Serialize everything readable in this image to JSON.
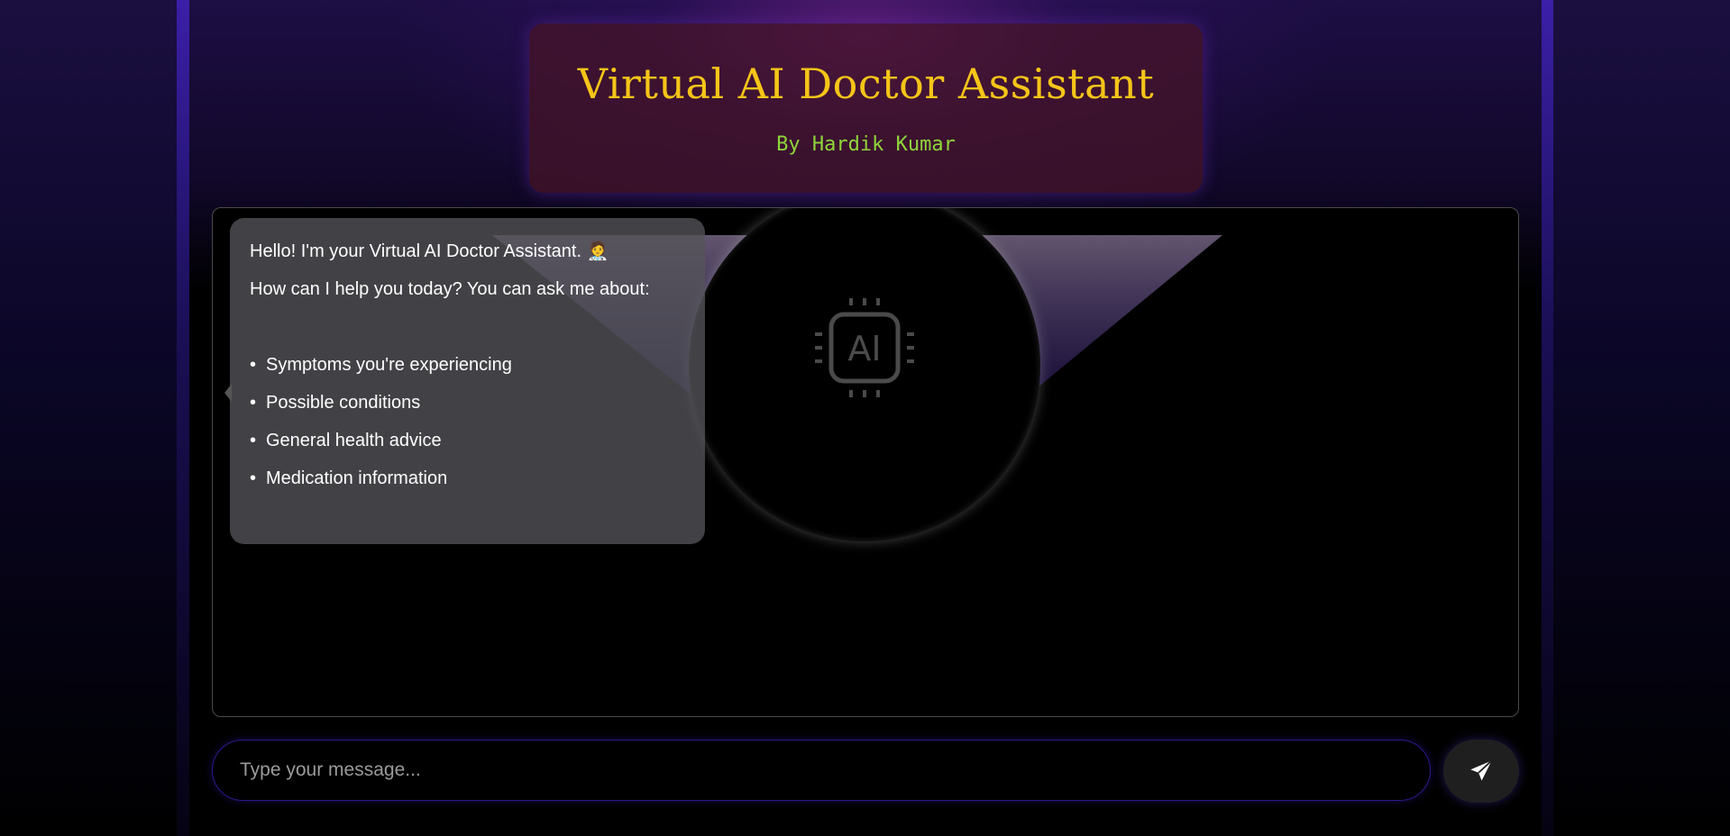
{
  "header": {
    "title": "Virtual AI Doctor Assistant",
    "subtitle": "By Hardik Kumar"
  },
  "chat": {
    "badge_label": "AI",
    "messages": [
      {
        "sender": "bot",
        "greeting": "Hello! I'm your Virtual AI Doctor Assistant. 🧑‍⚕️",
        "prompt": "How can I help you today? You can ask me about:",
        "bullet_symbol": "•",
        "topics": [
          "Symptoms you're experiencing",
          "Possible conditions",
          "General health advice",
          "Medication information"
        ]
      }
    ]
  },
  "composer": {
    "placeholder": "Type your message...",
    "value": "",
    "send_icon": "paper-plane-icon"
  },
  "colors": {
    "title": "#f5c518",
    "subtitle": "#8fd63a",
    "accent_glow": "#5a28a0"
  }
}
